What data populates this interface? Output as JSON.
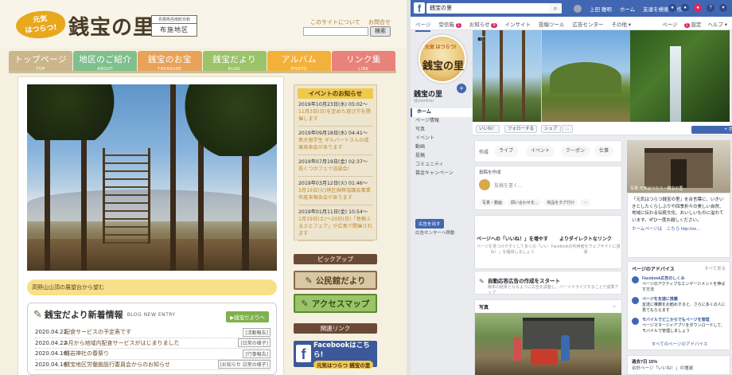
{
  "site": {
    "logo_badge": "元気\nはつらつ!",
    "logo_title": "銭宝の里",
    "logo_sub_top": "島根県邑南町日和",
    "logo_sub_bottom": "布施地区",
    "top_links": [
      "このサイトについて",
      "お問合せ"
    ],
    "search_button": "検索",
    "nav": [
      {
        "jp": "トップページ",
        "en": "TOP",
        "color": "#cbb68c"
      },
      {
        "jp": "地区のご紹介",
        "en": "ABOUT",
        "color": "#7fc08d"
      },
      {
        "jp": "銭宝のお宝",
        "en": "TREASURE",
        "color": "#e8a25a"
      },
      {
        "jp": "銭宝だより",
        "en": "BLOG",
        "color": "#9bc36b"
      },
      {
        "jp": "アルバム",
        "en": "PHOTO",
        "color": "#f3b13b"
      },
      {
        "jp": "リンク集",
        "en": "LINK",
        "color": "#e8827a"
      }
    ],
    "hero_caption": "高野山山頂の展望台から望む",
    "news": {
      "title": "銭宝だより新着情報",
      "title_en": "BLOG NEW ENTRY",
      "more": "銭宝だよりへ",
      "items": [
        {
          "date": "2020.04.22",
          "title": "配食サービスの予定表です",
          "cat": "[活動報告]"
        },
        {
          "date": "2020.04.22",
          "title": "4月から地域内配食サービスがはじまりました",
          "cat": "[日常の様子]"
        },
        {
          "date": "2020.04.16",
          "title": "雛岩神社の春祭り",
          "cat": "[行事報告]"
        },
        {
          "date": "2020.04.16",
          "title": "銭宝地区労働施設行委員会からのお知らせ",
          "cat": "[お知らせ 日常の様子]"
        }
      ]
    },
    "events": {
      "title": "イベントのお知らせ",
      "items": [
        {
          "date": "2019年10月23日(水) 05:02〜",
          "text": "11月3日(日)を定めた遊び方を開催します"
        },
        {
          "date": "2019年09月18日(水) 04:41〜",
          "text": "島大留学生 ギルバートさんの成果発表会があります"
        },
        {
          "date": "2019年07月19日(金) 02:37〜",
          "text": "長くつカフェで浴語会!"
        },
        {
          "date": "2019年03月12日(火) 01:46〜",
          "text": "3月19日(火)地区振興協議会事業 年度末報告会があります"
        },
        {
          "date": "2019年01月11日(金) 10:54〜",
          "text": "1月19日(土)〜20日(日)「島根ふるさとフェア」が広島で開催されます"
        }
      ]
    },
    "pickup_title": "ピックアップ",
    "banner_kouminkan": "公民館だより",
    "banner_access": "アクセスマップ",
    "kanren_title": "関連リンク",
    "banner_fb_main": "Facebookはこちら!",
    "banner_fb_sub": "元気はつらつ 銭宝の里"
  },
  "facebook": {
    "search_value": "銭宝の里",
    "top_right": [
      "上田 雅明",
      "ホーム",
      "友達を検索",
      "作成"
    ],
    "tabs_left": [
      "ページ",
      "受信箱",
      "お知らせ",
      "インサイト",
      "投稿ツール",
      "広告センター",
      "その他 ▾"
    ],
    "tabs_right": [
      "ページ",
      "設定",
      "ヘルプ ▾"
    ],
    "inbox_badge": "1",
    "notif_badge": "9",
    "settings_badge": "1",
    "page_name": "銭宝の里",
    "page_id": "@zenihou",
    "nav": [
      "ホーム",
      "ページ情報",
      "写真",
      "イベント",
      "動画",
      "投稿",
      "コミュニティ",
      "募金キャンペーン"
    ],
    "promote": "広告を出す",
    "ad_center": "広告センターへ移動",
    "actions": [
      "いいね！",
      "フォローする",
      "シェア",
      "…"
    ],
    "cta": "+ ボタンを追加",
    "create_label": "作成",
    "create_pills": [
      "ライブ",
      "イベント",
      "クーポン",
      "仕事"
    ],
    "post_label": "投稿を作成",
    "post_placeholder": "投稿を書く...",
    "post_options": [
      "写真・動画",
      "間い合わせを...",
      "商品をタグ付け",
      "…"
    ],
    "likes_col1_title": "ページへの「いいね！」を増やす",
    "likes_col1_body": "ページを見つけやすくして多くの「いいね！」を獲得しましょう",
    "likes_col2_title": "よりダイレクトなリンク",
    "likes_col2_body": "Facebookの利用者をウェブサイトに誘導",
    "auto_title": "自動応答広告の作成をスタート",
    "auto_body": "簡単の結果となるように広告を調整し、パーソナライズすることで成果アップ",
    "photos_title": "写真",
    "rphoto_caption": "写真 元気はつらつ・銭宝の里",
    "about_text": "「元気はつらつ銭宝の里」を合言葉に、いきいきとしたくらしぶりや四季折々の美しい自然、地域に伝わる伝統文化、おいしいものに溢れています。ぜひ一度お越しください。",
    "about_hp_label": "ホームページは　こちら",
    "about_hp_link": "http://ze...",
    "advice_title": "ページのアドバイス",
    "advice_all": "すべて見る",
    "advice_items": [
      {
        "title": "Facebook広告のしくみ",
        "body": "ページのアクティブなエンゲージメントを伸ばす方法"
      },
      {
        "title": "ページを友達に推薦",
        "body": "友達に推薦をお勧めすると、さらに多くの人に見てもらえます"
      },
      {
        "title": "モバイルでどこからでもページを管理",
        "body": "ページマネージャアプリをダウンロードして、モバイルで管理しましょう"
      }
    ],
    "advice_footer": "すべてのページのアドバイス",
    "bottom_text": "過去7日 15%",
    "bottom_sub": "合計ページ「いいね！」の増減"
  }
}
